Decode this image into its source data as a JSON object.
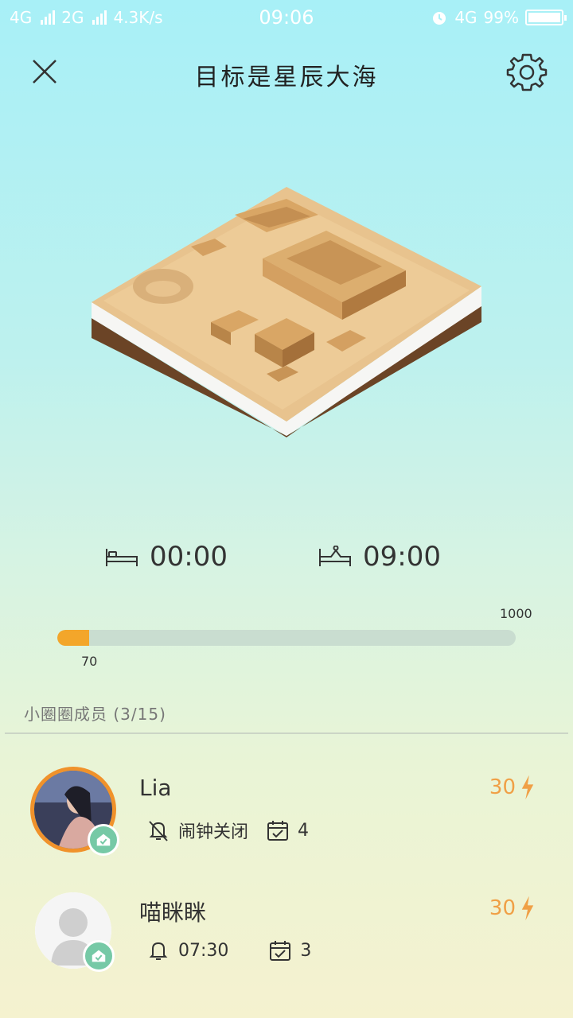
{
  "status": {
    "network_left": "4G",
    "network_right": "2G",
    "speed": "4.3K/s",
    "time": "09:06",
    "network_main": "4G",
    "battery": "99%"
  },
  "header": {
    "title": "目标是星辰大海"
  },
  "schedule": {
    "sleep_time": "00:00",
    "wake_time": "09:00"
  },
  "progress": {
    "current": "70",
    "max": "1000",
    "fraction": 0.07
  },
  "members_header": "小圈圈成员 (3/15)",
  "members": [
    {
      "name": "Lia",
      "score": "30",
      "alarm": "闹钟关闭",
      "checkins": "4"
    },
    {
      "name": "喵眯眯",
      "score": "30",
      "alarm": "07:30",
      "checkins": "3"
    }
  ],
  "colors": {
    "accent": "#f3a62a",
    "badge": "#76c9a6"
  }
}
